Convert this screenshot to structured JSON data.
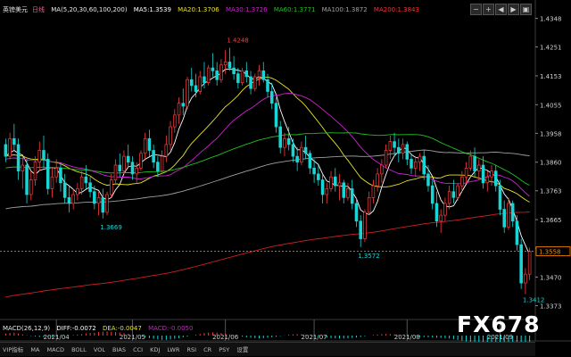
{
  "header": {
    "symbol": "英镑美元",
    "timeframe": "日线",
    "ma_title": "MA(5,20,30,60,100,200)",
    "ma5": "MA5:1.3539",
    "ma20": "MA20:1.3706",
    "ma30": "MA30:1.3726",
    "ma60": "MA60:1.3771",
    "ma100": "MA100:1.3872",
    "ma200": "MA200:1.3843",
    "controls": [
      "−",
      "+",
      "◀",
      "▶",
      "▣"
    ]
  },
  "macd": {
    "title": "MACD(26,12,9)",
    "diff": "DIFF:-0.0072",
    "dea": "DEA:-0.0047",
    "macd": "MACD:-0.0050"
  },
  "toolbar": [
    "VIP指标",
    "MA",
    "MACD",
    "BOLL",
    "VOL",
    "BIAS",
    "CCI",
    "KDJ",
    "LWR",
    "RSI",
    "CR",
    "PSY",
    "设置"
  ],
  "watermark": "FX678",
  "colors": {
    "up": "#ff3c3c",
    "down": "#19d6d6",
    "ma5": "#ffffff",
    "ma20": "#e8e22c",
    "ma30": "#d020d0",
    "ma60": "#20c020",
    "ma100": "#a0a0a0",
    "ma200": "#d02020",
    "current_price": "#ff8c00"
  },
  "chart_data": {
    "type": "candlestick",
    "y_axis": {
      "ticks": [
        "1.4348",
        "1.4251",
        "1.4153",
        "1.4055",
        "1.3958",
        "1.3860",
        "1.3763",
        "1.3665",
        "1.3568",
        "1.3470",
        "1.3373"
      ],
      "range": [
        1.3326,
        1.4368
      ]
    },
    "x_axis": {
      "ticks": [
        "2021/04",
        "2021/05",
        "2021/06",
        "2021/07",
        "2021/08",
        "2021/09"
      ]
    },
    "current_price": "1.3558",
    "annotations": [
      {
        "label": "1.4248",
        "value": 1.4248
      },
      {
        "label": "1.3669",
        "value": 1.3669
      },
      {
        "label": "1.3572",
        "value": 1.3572
      },
      {
        "label": "1.3412",
        "value": 1.3412
      }
    ],
    "candles": [
      [
        1.392,
        1.394,
        1.386,
        1.388
      ],
      [
        1.388,
        1.396,
        1.387,
        1.394
      ],
      [
        1.394,
        1.399,
        1.39,
        1.392
      ],
      [
        1.392,
        1.394,
        1.38,
        1.383
      ],
      [
        1.383,
        1.388,
        1.377,
        1.385
      ],
      [
        1.385,
        1.387,
        1.372,
        1.375
      ],
      [
        1.375,
        1.383,
        1.373,
        1.38
      ],
      [
        1.38,
        1.388,
        1.378,
        1.386
      ],
      [
        1.386,
        1.393,
        1.383,
        1.39
      ],
      [
        1.39,
        1.395,
        1.384,
        1.387
      ],
      [
        1.387,
        1.389,
        1.375,
        1.377
      ],
      [
        1.377,
        1.384,
        1.374,
        1.381
      ],
      [
        1.381,
        1.387,
        1.379,
        1.384
      ],
      [
        1.384,
        1.386,
        1.376,
        1.379
      ],
      [
        1.379,
        1.382,
        1.372,
        1.374
      ],
      [
        1.374,
        1.378,
        1.369,
        1.372
      ],
      [
        1.372,
        1.377,
        1.37,
        1.375
      ],
      [
        1.375,
        1.379,
        1.373,
        1.377
      ],
      [
        1.377,
        1.383,
        1.375,
        1.381
      ],
      [
        1.381,
        1.385,
        1.377,
        1.379
      ],
      [
        1.379,
        1.381,
        1.374,
        1.376
      ],
      [
        1.376,
        1.378,
        1.37,
        1.372
      ],
      [
        1.372,
        1.376,
        1.368,
        1.374
      ],
      [
        1.374,
        1.377,
        1.3669,
        1.369
      ],
      [
        1.369,
        1.376,
        1.368,
        1.375
      ],
      [
        1.375,
        1.382,
        1.374,
        1.38
      ],
      [
        1.38,
        1.387,
        1.379,
        1.385
      ],
      [
        1.385,
        1.389,
        1.381,
        1.383
      ],
      [
        1.383,
        1.39,
        1.382,
        1.388
      ],
      [
        1.388,
        1.392,
        1.384,
        1.386
      ],
      [
        1.386,
        1.388,
        1.38,
        1.382
      ],
      [
        1.382,
        1.386,
        1.379,
        1.384
      ],
      [
        1.384,
        1.39,
        1.383,
        1.389
      ],
      [
        1.389,
        1.396,
        1.387,
        1.394
      ],
      [
        1.394,
        1.397,
        1.388,
        1.39
      ],
      [
        1.39,
        1.392,
        1.384,
        1.386
      ],
      [
        1.386,
        1.388,
        1.381,
        1.383
      ],
      [
        1.383,
        1.39,
        1.382,
        1.388
      ],
      [
        1.388,
        1.395,
        1.386,
        1.392
      ],
      [
        1.392,
        1.4,
        1.39,
        1.398
      ],
      [
        1.398,
        1.404,
        1.396,
        1.402
      ],
      [
        1.402,
        1.408,
        1.399,
        1.406
      ],
      [
        1.406,
        1.411,
        1.402,
        1.405
      ],
      [
        1.405,
        1.415,
        1.404,
        1.414
      ],
      [
        1.414,
        1.418,
        1.41,
        1.412
      ],
      [
        1.412,
        1.416,
        1.408,
        1.41
      ],
      [
        1.41,
        1.417,
        1.409,
        1.415
      ],
      [
        1.415,
        1.42,
        1.411,
        1.413
      ],
      [
        1.413,
        1.419,
        1.412,
        1.418
      ],
      [
        1.418,
        1.423,
        1.415,
        1.417
      ],
      [
        1.417,
        1.42,
        1.412,
        1.414
      ],
      [
        1.414,
        1.421,
        1.413,
        1.419
      ],
      [
        1.419,
        1.424,
        1.416,
        1.42
      ],
      [
        1.42,
        1.4248,
        1.417,
        1.418
      ],
      [
        1.418,
        1.422,
        1.414,
        1.416
      ],
      [
        1.416,
        1.418,
        1.411,
        1.413
      ],
      [
        1.413,
        1.418,
        1.412,
        1.417
      ],
      [
        1.417,
        1.42,
        1.413,
        1.415
      ],
      [
        1.415,
        1.417,
        1.409,
        1.411
      ],
      [
        1.411,
        1.416,
        1.41,
        1.415
      ],
      [
        1.415,
        1.419,
        1.412,
        1.417
      ],
      [
        1.417,
        1.42,
        1.413,
        1.414
      ],
      [
        1.414,
        1.416,
        1.408,
        1.41
      ],
      [
        1.41,
        1.413,
        1.404,
        1.406
      ],
      [
        1.406,
        1.408,
        1.396,
        1.398
      ],
      [
        1.398,
        1.4,
        1.389,
        1.391
      ],
      [
        1.391,
        1.396,
        1.388,
        1.394
      ],
      [
        1.394,
        1.398,
        1.39,
        1.392
      ],
      [
        1.392,
        1.394,
        1.386,
        1.388
      ],
      [
        1.388,
        1.391,
        1.383,
        1.386
      ],
      [
        1.386,
        1.393,
        1.385,
        1.391
      ],
      [
        1.391,
        1.395,
        1.387,
        1.389
      ],
      [
        1.389,
        1.39,
        1.382,
        1.384
      ],
      [
        1.384,
        1.387,
        1.379,
        1.382
      ],
      [
        1.382,
        1.385,
        1.378,
        1.38
      ],
      [
        1.38,
        1.382,
        1.372,
        1.375
      ],
      [
        1.375,
        1.379,
        1.372,
        1.377
      ],
      [
        1.377,
        1.383,
        1.376,
        1.381
      ],
      [
        1.381,
        1.384,
        1.376,
        1.378
      ],
      [
        1.378,
        1.382,
        1.373,
        1.379
      ],
      [
        1.379,
        1.38,
        1.372,
        1.374
      ],
      [
        1.374,
        1.379,
        1.373,
        1.377
      ],
      [
        1.377,
        1.38,
        1.37,
        1.372
      ],
      [
        1.372,
        1.374,
        1.364,
        1.366
      ],
      [
        1.366,
        1.368,
        1.3572,
        1.36
      ],
      [
        1.36,
        1.37,
        1.359,
        1.369
      ],
      [
        1.369,
        1.376,
        1.368,
        1.374
      ],
      [
        1.374,
        1.38,
        1.372,
        1.378
      ],
      [
        1.378,
        1.384,
        1.376,
        1.382
      ],
      [
        1.382,
        1.387,
        1.379,
        1.385
      ],
      [
        1.385,
        1.392,
        1.384,
        1.39
      ],
      [
        1.39,
        1.395,
        1.387,
        1.393
      ],
      [
        1.393,
        1.396,
        1.388,
        1.391
      ],
      [
        1.391,
        1.394,
        1.386,
        1.389
      ],
      [
        1.389,
        1.394,
        1.387,
        1.392
      ],
      [
        1.392,
        1.393,
        1.385,
        1.387
      ],
      [
        1.387,
        1.389,
        1.382,
        1.384
      ],
      [
        1.384,
        1.388,
        1.381,
        1.386
      ],
      [
        1.386,
        1.389,
        1.383,
        1.388
      ],
      [
        1.388,
        1.39,
        1.38,
        1.382
      ],
      [
        1.382,
        1.385,
        1.376,
        1.378
      ],
      [
        1.378,
        1.38,
        1.37,
        1.372
      ],
      [
        1.372,
        1.376,
        1.364,
        1.366
      ],
      [
        1.366,
        1.37,
        1.362,
        1.368
      ],
      [
        1.368,
        1.374,
        1.366,
        1.372
      ],
      [
        1.372,
        1.378,
        1.37,
        1.376
      ],
      [
        1.376,
        1.38,
        1.372,
        1.374
      ],
      [
        1.374,
        1.379,
        1.373,
        1.378
      ],
      [
        1.378,
        1.383,
        1.376,
        1.381
      ],
      [
        1.381,
        1.386,
        1.379,
        1.384
      ],
      [
        1.384,
        1.39,
        1.383,
        1.388
      ],
      [
        1.388,
        1.391,
        1.381,
        1.383
      ],
      [
        1.383,
        1.387,
        1.38,
        1.385
      ],
      [
        1.385,
        1.388,
        1.377,
        1.379
      ],
      [
        1.379,
        1.383,
        1.376,
        1.381
      ],
      [
        1.381,
        1.385,
        1.378,
        1.383
      ],
      [
        1.383,
        1.385,
        1.376,
        1.378
      ],
      [
        1.378,
        1.38,
        1.368,
        1.37
      ],
      [
        1.37,
        1.373,
        1.362,
        1.364
      ],
      [
        1.364,
        1.374,
        1.363,
        1.372
      ],
      [
        1.372,
        1.373,
        1.364,
        1.366
      ],
      [
        1.366,
        1.368,
        1.356,
        1.358
      ],
      [
        1.358,
        1.36,
        1.343,
        1.345
      ],
      [
        1.345,
        1.35,
        1.3412,
        1.348
      ],
      [
        1.348,
        1.357,
        1.346,
        1.3558
      ]
    ],
    "macd_hist": [
      0.001,
      0.0012,
      0.0014,
      0.001,
      0.0006,
      0.0002,
      -0.0002,
      -0.0004,
      -0.0006,
      -0.0008,
      -0.0008,
      -0.0007,
      -0.0005,
      -0.0003,
      -0.0001,
      0.0001,
      0.0003,
      0.0005,
      0.0007,
      0.001,
      0.0012,
      0.0014,
      0.0016,
      0.0018,
      0.0019,
      0.0018,
      0.0016,
      0.0014,
      0.0011,
      0.0008,
      0.0004,
      0.0,
      -0.0004,
      -0.0008,
      -0.0012,
      -0.0015,
      -0.0018,
      -0.002,
      -0.002,
      -0.0018,
      -0.0015,
      -0.0012,
      -0.0008,
      -0.0004,
      0.0,
      0.0004,
      0.0008,
      0.0012,
      0.0014,
      0.0015,
      0.0014,
      0.0012,
      0.0009,
      0.0005,
      0.0002,
      -0.0002,
      -0.0005,
      -0.0008,
      -0.001,
      -0.0012,
      -0.0013,
      -0.0012,
      -0.001,
      -0.0008,
      -0.0005,
      -0.0002,
      0.0001,
      0.0004,
      0.0006,
      0.0007,
      0.0006,
      0.0004,
      0.0001,
      -0.0002,
      -0.0005,
      -0.0008,
      -0.001,
      -0.0012,
      -0.0013,
      -0.0014,
      -0.0014,
      -0.0013,
      -0.0011,
      -0.0009,
      -0.0006,
      -0.0003,
      0.0,
      0.0003,
      0.0005,
      0.0007,
      0.0008,
      0.0007,
      0.0005,
      0.0003,
      0.0001,
      -0.0001,
      -0.0003,
      -0.0005,
      -0.0006,
      -0.0007,
      -0.0008,
      -0.0009,
      -0.001,
      -0.0011,
      -0.0012,
      -0.0014,
      -0.0017,
      -0.002,
      -0.0024,
      -0.0028,
      -0.0032,
      -0.0036,
      -0.004,
      -0.0044,
      -0.0048,
      -0.005,
      -0.005,
      -0.005,
      -0.005,
      -0.005,
      -0.005,
      -0.005,
      -0.005,
      -0.005,
      -0.005
    ]
  }
}
